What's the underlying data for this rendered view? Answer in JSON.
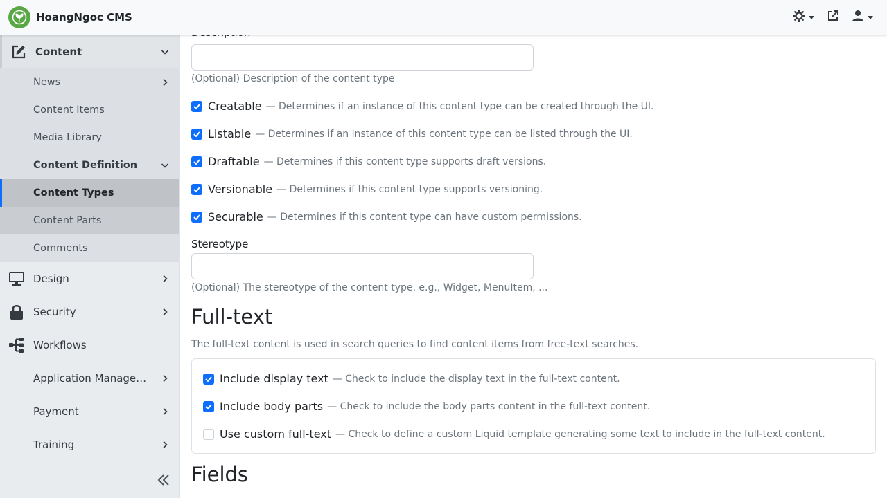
{
  "app": {
    "brand_name": "HoangNgoc CMS",
    "brand_color": "#5aa845",
    "accent_color": "#0d6efd"
  },
  "topbar": {
    "theme_icon": "sun-icon",
    "external_icon": "external-link-icon",
    "user_icon": "user-icon"
  },
  "sidebar": {
    "content": {
      "label": "Content",
      "icon": "edit-icon"
    },
    "content_items": [
      {
        "label": "News"
      },
      {
        "label": "Content Items"
      },
      {
        "label": "Media Library"
      },
      {
        "label": "Content Definition"
      },
      {
        "label": "Content Types"
      },
      {
        "label": "Content Parts"
      },
      {
        "label": "Comments"
      }
    ],
    "items": [
      {
        "label": "Design",
        "icon": "desktop-icon"
      },
      {
        "label": "Security",
        "icon": "lock-icon"
      },
      {
        "label": "Workflows",
        "icon": "sitemap-icon"
      },
      {
        "label": "Application Management"
      },
      {
        "label": "Payment"
      },
      {
        "label": "Training"
      }
    ],
    "collapse_icon": "double-chevron-left-icon"
  },
  "form": {
    "description": {
      "label": "Description",
      "value": "",
      "hint": "(Optional) Description of the content type"
    },
    "options": [
      {
        "title": "Creatable",
        "desc": "— Determines if an instance of this content type can be created through the UI.",
        "checked": true
      },
      {
        "title": "Listable",
        "desc": "— Determines if an instance of this content type can be listed through the UI.",
        "checked": true
      },
      {
        "title": "Draftable",
        "desc": "— Determines if this content type supports draft versions.",
        "checked": true
      },
      {
        "title": "Versionable",
        "desc": "— Determines if this content type supports versioning.",
        "checked": true
      },
      {
        "title": "Securable",
        "desc": "— Determines if this content type can have custom permissions.",
        "checked": true
      }
    ],
    "stereotype": {
      "label": "Stereotype",
      "value": "",
      "hint": "(Optional) The stereotype of the content type. e.g., Widget, MenuItem, ..."
    }
  },
  "fulltext": {
    "title": "Full-text",
    "intro": "The full-text content is used in search queries to find content items from free-text searches.",
    "options": [
      {
        "title": "Include display text",
        "desc": "— Check to include the display text in the full-text content.",
        "checked": true
      },
      {
        "title": "Include body parts",
        "desc": "— Check to include the body parts content in the full-text content.",
        "checked": true
      },
      {
        "title": "Use custom full-text",
        "desc": "— Check to define a custom Liquid template generating some text to include in the full-text content.",
        "checked": false
      }
    ]
  },
  "fields": {
    "title": "Fields"
  }
}
